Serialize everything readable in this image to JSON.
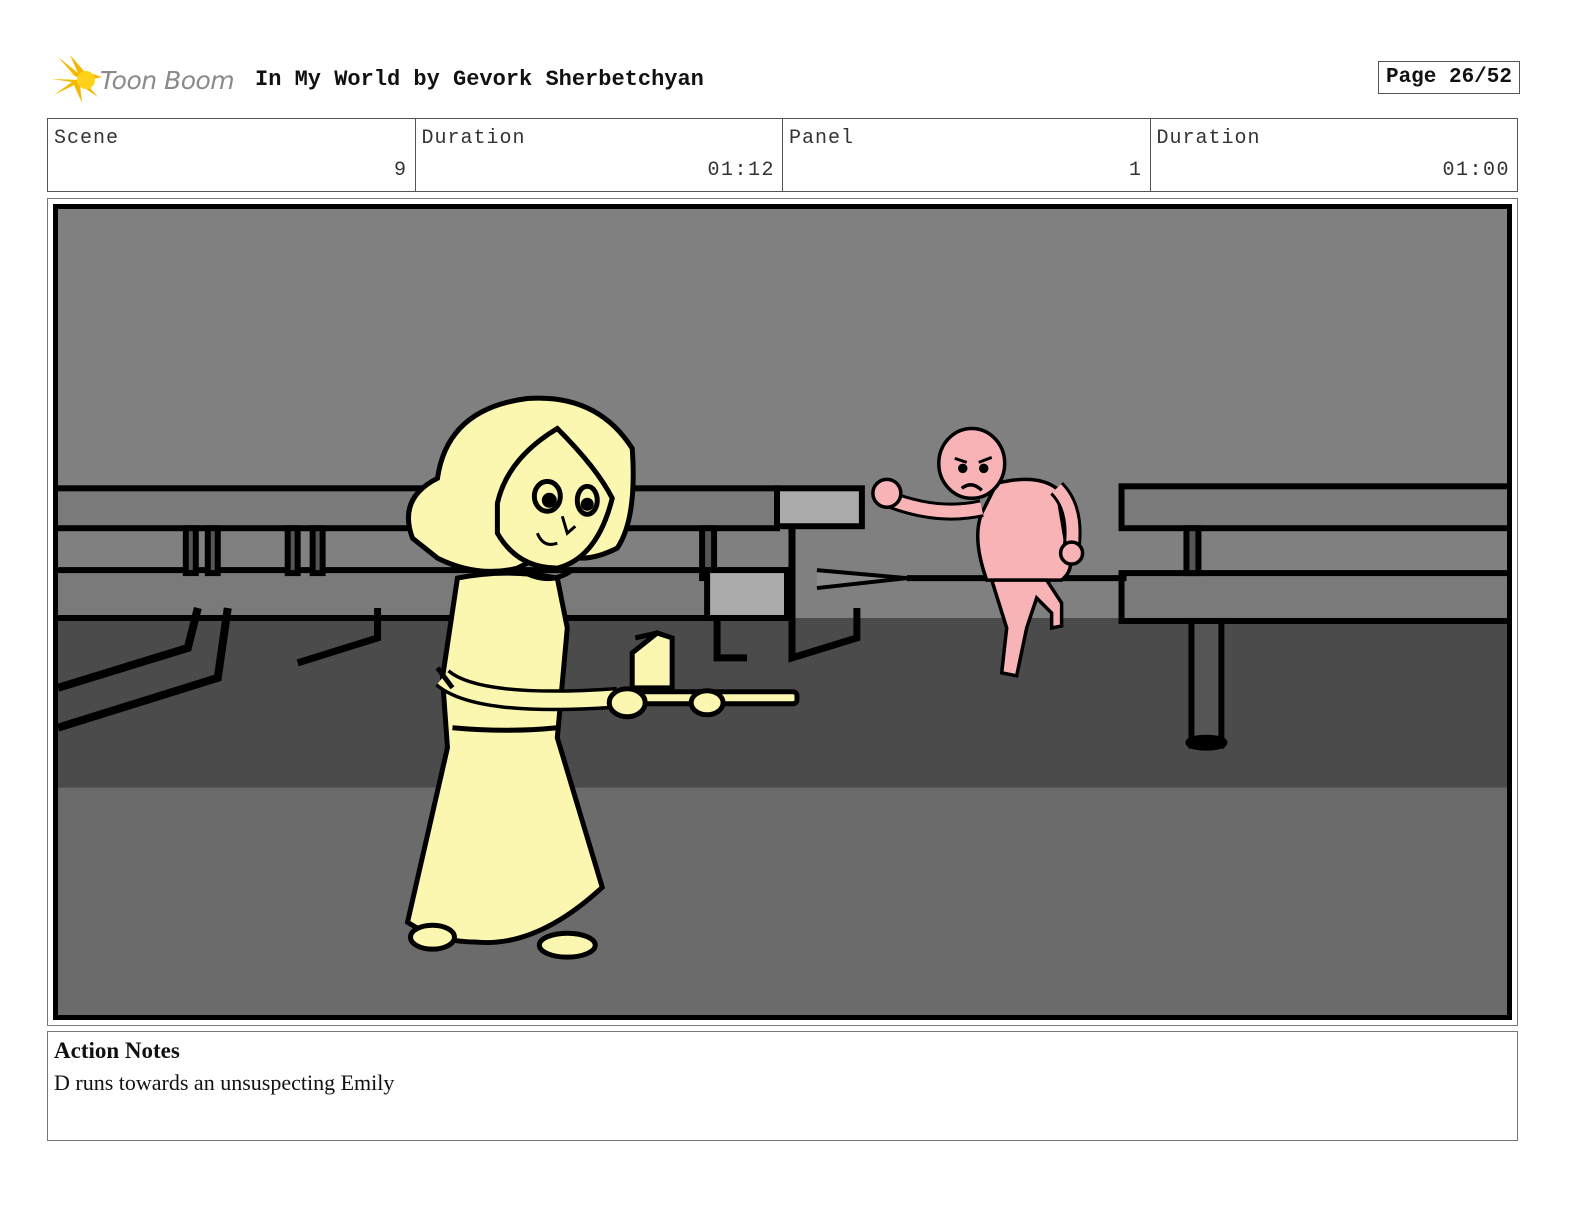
{
  "header": {
    "logo_text": "Toon Boom",
    "project_title": "In My World by Gevork Sherbetchyan",
    "page_label": "Page 26/52"
  },
  "info": {
    "scene_label": "Scene",
    "scene_value": "9",
    "scene_duration_label": "Duration",
    "scene_duration_value": "01:12",
    "panel_label": "Panel",
    "panel_value": "1",
    "panel_duration_label": "Duration",
    "panel_duration_value": "01:00"
  },
  "panel": {
    "image_icon": "storyboard-drawing"
  },
  "notes": {
    "title": "Action Notes",
    "text": "D runs towards an unsuspecting Emily"
  },
  "colors": {
    "emily_fill": "#fbf7b0",
    "runner_fill": "#f7b3b6",
    "wall": "#808080",
    "floor": "#4b4b4b"
  }
}
